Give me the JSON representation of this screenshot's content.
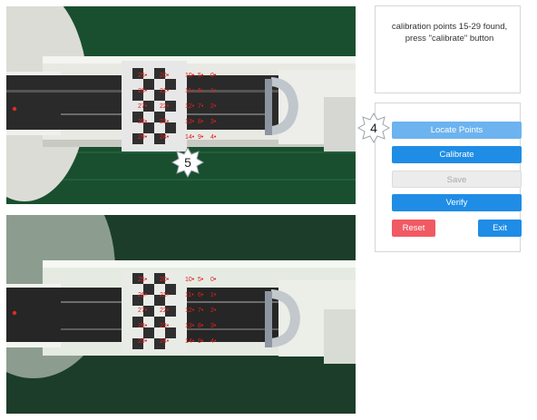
{
  "camera_views": [
    {
      "name": "top",
      "labels_right": [
        "10",
        "5",
        "0",
        "11",
        "6",
        "1",
        "12",
        "7",
        "2",
        "13",
        "8",
        "3",
        "14",
        "9",
        "4"
      ],
      "labels_left": [
        "25",
        "20",
        "26",
        "21",
        "27",
        "22",
        "28",
        "23",
        "29",
        "24"
      ]
    },
    {
      "name": "bottom",
      "labels_right": [
        "10",
        "5",
        "0",
        "11",
        "6",
        "1",
        "12",
        "7",
        "2",
        "13",
        "8",
        "3",
        "14",
        "9",
        "4"
      ],
      "labels_left": [
        "25",
        "20",
        "26",
        "21",
        "27",
        "22",
        "28",
        "23",
        "29",
        "24"
      ]
    }
  ],
  "status": {
    "message": "calibration points 15-29 found, press \"calibrate\" button"
  },
  "controls": {
    "locate_label": "Locate Points",
    "calibrate_label": "Calibrate",
    "save_label": "Save",
    "verify_label": "Verify",
    "reset_label": "Reset",
    "exit_label": "Exit"
  },
  "callouts": {
    "top_view_number": "5",
    "controls_number": "4"
  },
  "colors": {
    "accent": "#1f8de5",
    "accent_light": "#6cb3ef",
    "danger": "#f05a63",
    "disabled": "#ececec",
    "marker": "#e0201d"
  }
}
